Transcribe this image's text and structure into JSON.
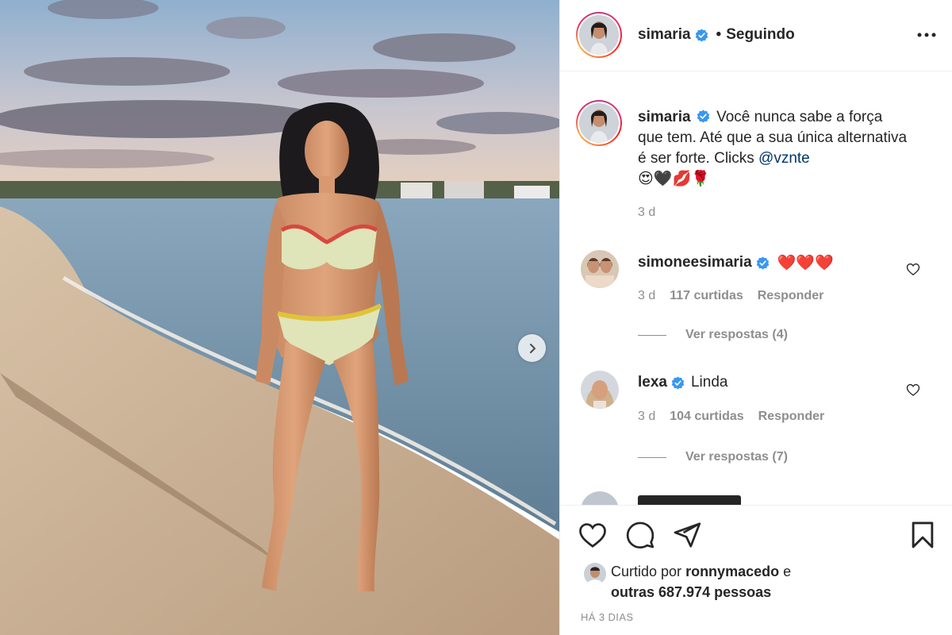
{
  "post": {
    "image_alt": "Woman in floral bikini standing on a beach at sunset"
  },
  "header": {
    "username": "simaria",
    "separator": "•",
    "follow_state": "Seguindo"
  },
  "caption": {
    "username": "simaria",
    "text": "Você nunca sabe a força que tem. Até que a sua única alternativa é ser forte. Clicks",
    "mention": "@vznte",
    "emojis": "😍🖤💋🌹",
    "time": "3 d"
  },
  "comments": [
    {
      "username": "simoneesimaria",
      "text": "❤️❤️❤️",
      "time": "3 d",
      "likes": "117 curtidas",
      "reply_label": "Responder",
      "view_replies": "Ver respostas (4)"
    },
    {
      "username": "lexa",
      "text": "Linda",
      "time": "3 d",
      "likes": "104 curtidas",
      "reply_label": "Responder",
      "view_replies": "Ver respostas (7)"
    }
  ],
  "footer": {
    "liked_by_prefix": "Curtido por",
    "liked_by_user": "ronnymacedo",
    "liked_by_joiner": "e",
    "liked_by_others": "outras 687.974 pessoas",
    "date": "HÁ 3 DIAS"
  },
  "colors": {
    "verified": "#3897f0",
    "mention": "#00376b",
    "muted": "#8e8e8e",
    "text": "#262626"
  },
  "icons": {
    "next": "chevron-right-icon",
    "more": "more-horizontal-icon",
    "like": "heart-icon",
    "comment": "comment-icon",
    "share": "paper-plane-icon",
    "save": "bookmark-icon",
    "verified": "verified-badge-icon"
  }
}
